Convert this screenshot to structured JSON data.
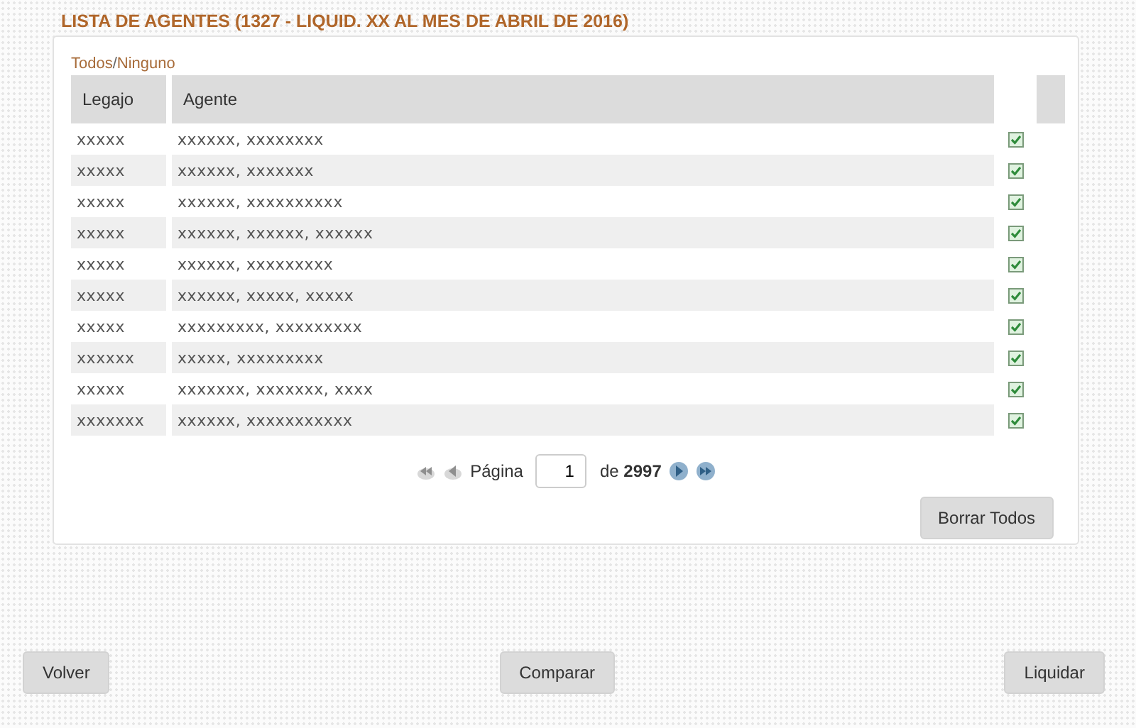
{
  "title": "LISTA DE AGENTES (1327 - LIQUID. XX AL MES DE ABRIL DE 2016)",
  "select_links": {
    "all": "Todos",
    "separator": "/",
    "none": "Ninguno"
  },
  "table": {
    "columns": [
      "Legajo",
      "Agente"
    ],
    "rows": [
      {
        "legajo": "xxxxx",
        "agente": "xxxxxx, xxxxxxxx",
        "checked": true
      },
      {
        "legajo": "xxxxx",
        "agente": "xxxxxx, xxxxxxx",
        "checked": true
      },
      {
        "legajo": "xxxxx",
        "agente": "xxxxxx, xxxxxxxxxx",
        "checked": true
      },
      {
        "legajo": "xxxxx",
        "agente": "xxxxxx, xxxxxx, xxxxxx",
        "checked": true
      },
      {
        "legajo": "xxxxx",
        "agente": "xxxxxx, xxxxxxxxx",
        "checked": true
      },
      {
        "legajo": "xxxxx",
        "agente": "xxxxxx, xxxxx, xxxxx",
        "checked": true
      },
      {
        "legajo": "xxxxx",
        "agente": "xxxxxxxxx, xxxxxxxxx",
        "checked": true
      },
      {
        "legajo": "xxxxxx",
        "agente": "xxxxx, xxxxxxxxx",
        "checked": true
      },
      {
        "legajo": "xxxxx",
        "agente": "xxxxxxx, xxxxxxx, xxxx",
        "checked": true
      },
      {
        "legajo": "xxxxxxx",
        "agente": "xxxxxx, xxxxxxxxxxx",
        "checked": true
      }
    ]
  },
  "pager": {
    "buttons": [
      {
        "kind": "first",
        "disabled": true
      },
      {
        "kind": "prev",
        "disabled": true
      },
      {
        "kind": "next",
        "disabled": false
      },
      {
        "kind": "last",
        "disabled": false
      }
    ],
    "label": "Página",
    "page": "1",
    "of": "de",
    "total": "2997"
  },
  "clear_button": "Borrar Todos",
  "footer_buttons": [
    "Volver",
    "Comparar",
    "Liquidar"
  ]
}
